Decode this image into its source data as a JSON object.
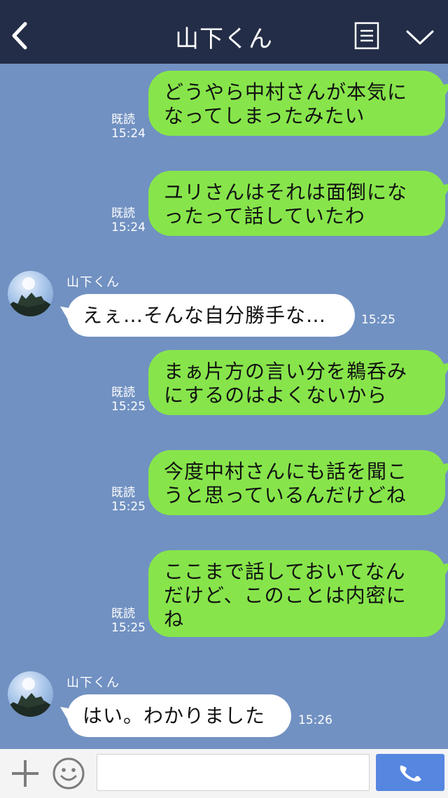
{
  "header": {
    "title": "山下くん",
    "back_icon": "chevron-left-icon",
    "memo_icon": "notes-icon",
    "menu_icon": "chevron-down-icon"
  },
  "messages": [
    {
      "type": "out",
      "lines": [
        "どうやら中村さんが本気に",
        "なってしまったみたい"
      ],
      "read": "既読",
      "time": "15:24"
    },
    {
      "type": "out",
      "lines": [
        "ユリさんはそれは面倒にな",
        "ったって話していたわ"
      ],
      "read": "既読",
      "time": "15:24"
    },
    {
      "type": "in",
      "sender": "山下くん",
      "lines": [
        "えぇ…そんな自分勝手な…"
      ],
      "time": "15:25"
    },
    {
      "type": "out",
      "lines": [
        "まぁ片方の言い分を鵜呑み",
        "にするのはよくないから"
      ],
      "read": "既読",
      "time": "15:25"
    },
    {
      "type": "out",
      "lines": [
        "今度中村さんにも話を聞こ",
        "うと思っているんだけどね"
      ],
      "read": "既読",
      "time": "15:25"
    },
    {
      "type": "out",
      "lines": [
        "ここまで話しておいてなん",
        "だけど、このことは内密に",
        "ね"
      ],
      "read": "既読",
      "time": "15:25"
    },
    {
      "type": "in",
      "sender": "山下くん",
      "lines": [
        "はい。わかりました"
      ],
      "time": "15:26"
    }
  ],
  "footer": {
    "plus_icon": "plus-icon",
    "emoji_icon": "emoji-icon",
    "input_value": "",
    "input_placeholder": "",
    "call_icon": "phone-icon"
  },
  "colors": {
    "header_bg": "#232d47",
    "chat_bg": "#7191c2",
    "outgoing_bubble": "#87e54b",
    "incoming_bubble": "#ffffff",
    "call_button": "#5586e0"
  }
}
